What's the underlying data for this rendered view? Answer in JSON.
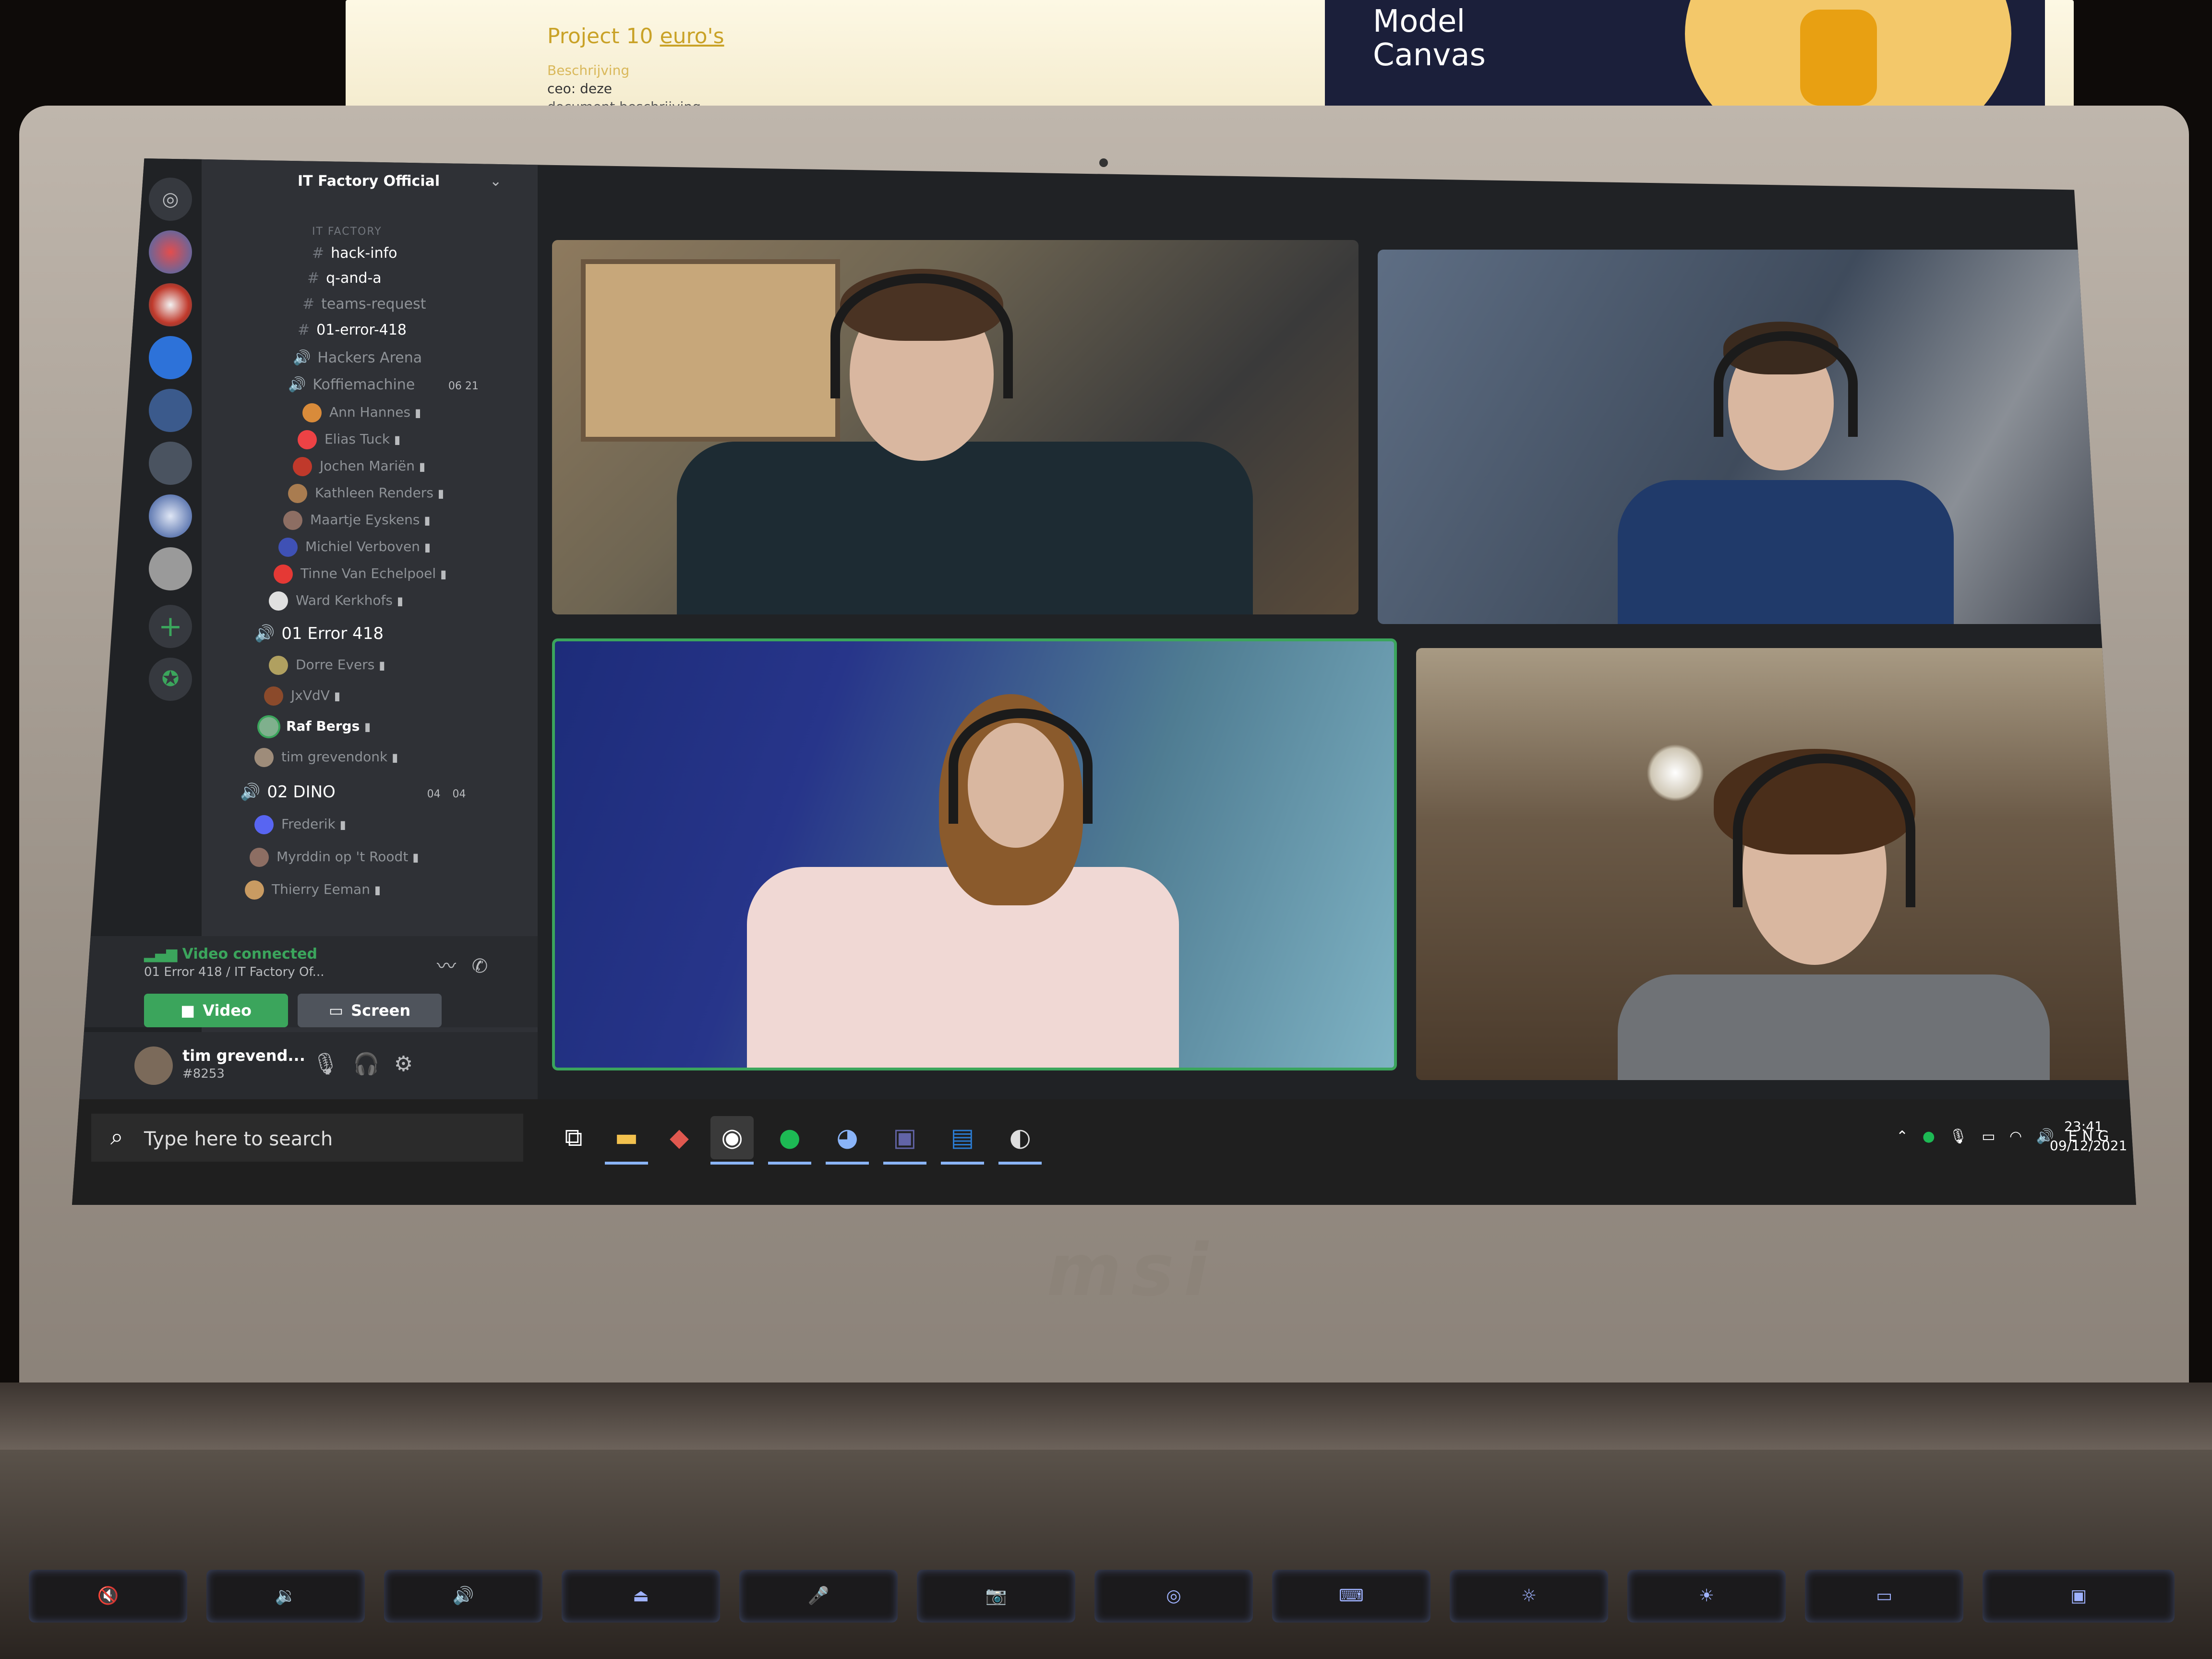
{
  "background_monitor": {
    "doc_title_prefix": "Project 10",
    "doc_title_link": "euro's",
    "doc_subtitle": "Beschrijving",
    "doc_line1": "ceo: deze",
    "doc_line2": "document beschrijving",
    "slide_title": "Model\nCanvas"
  },
  "discord": {
    "server_name": "IT Factory Official",
    "category": "IT FACTORY",
    "text_channels": [
      "hack-info",
      "q-and-a",
      "teams-request",
      "01-error-418"
    ],
    "voice_channels_top": [
      {
        "name": "Hackers Arena"
      },
      {
        "name": "Koffiemachine",
        "count": "06 21"
      }
    ],
    "koffie_members": [
      "Ann Hannes",
      "Elias Tuck",
      "Jochen Mariën",
      "Kathleen Renders",
      "Maartje Eyskens",
      "Michiel Verboven",
      "Tinne Van Echelpoel",
      "Ward Kerkhofs"
    ],
    "vc1": {
      "name": "01 Error 418",
      "members": [
        "Dorre Evers",
        "JxVdV",
        "Raf Bergs",
        "tim grevendonk"
      ]
    },
    "vc2": {
      "name": "02 DINO",
      "count_a": "04",
      "count_b": "04",
      "members": [
        "Frederik",
        "Myrddin op 't Roodt",
        "Thierry Eeman"
      ]
    },
    "connection": {
      "status": "Video connected",
      "channel": "01 Error 418 / IT Factory Of..."
    },
    "buttons": {
      "video": "Video",
      "screen": "Screen"
    },
    "user": {
      "name": "tim grevend...",
      "tag": "#8253"
    }
  },
  "taskbar": {
    "search_placeholder": "Type here to search",
    "tray_lang": "ENG",
    "time": "23:41",
    "date": "09/12/2021"
  },
  "laptop": {
    "brand": "msi"
  },
  "colors": {
    "discord_bg": "#2f3136",
    "rail_bg": "#202225",
    "green": "#3ba55c",
    "active_speaker_border": "#3ba55c"
  }
}
